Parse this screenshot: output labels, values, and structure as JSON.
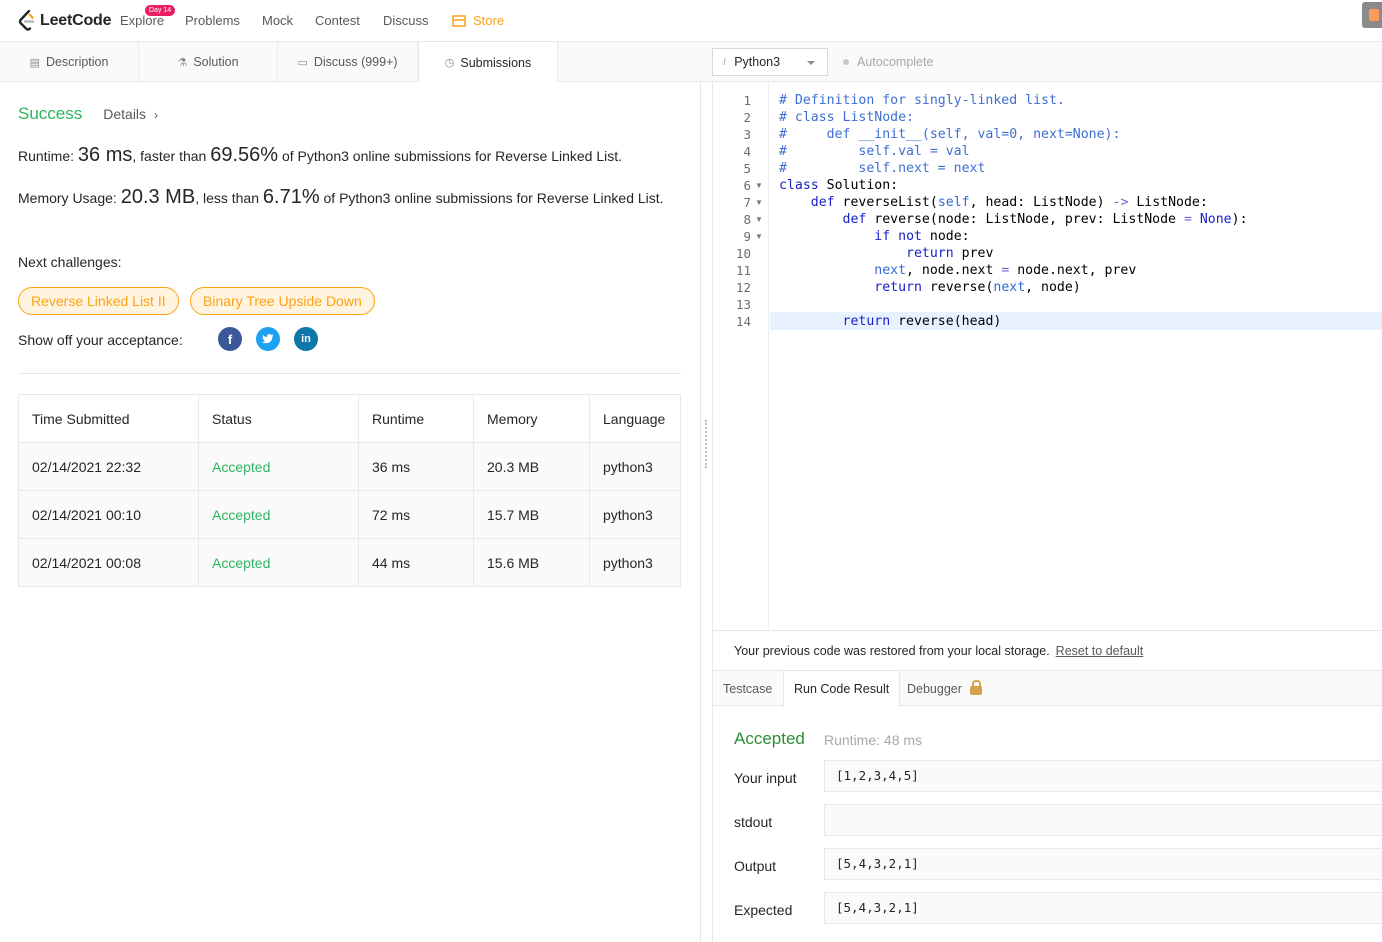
{
  "nav": {
    "logo": "LeetCode",
    "explore": "Explore",
    "explore_badge": "Day 14",
    "problems": "Problems",
    "mock": "Mock",
    "contest": "Contest",
    "discuss": "Discuss",
    "store": "Store"
  },
  "tabs": {
    "description": "Description",
    "solution": "Solution",
    "discuss": "Discuss (999+)",
    "submissions": "Submissions"
  },
  "editor_toolbar": {
    "language": "Python3",
    "autocomplete": "Autocomplete"
  },
  "result": {
    "status": "Success",
    "details": "Details",
    "runtime_label": "Runtime: ",
    "runtime_value": "36 ms",
    "runtime_mid": ", faster than ",
    "runtime_pct": "69.56%",
    "runtime_suffix": " of Python3 online submissions for Reverse Linked List.",
    "memory_label": "Memory Usage: ",
    "memory_value": "20.3 MB",
    "memory_mid": ", less than ",
    "memory_pct": "6.71%",
    "memory_suffix": " of Python3 online submissions for Reverse Linked List.",
    "next_label": "Next challenges:",
    "challenges": [
      "Reverse Linked List II",
      "Binary Tree Upside Down"
    ],
    "share_label": "Show off your acceptance:"
  },
  "submissions": {
    "headers": [
      "Time Submitted",
      "Status",
      "Runtime",
      "Memory",
      "Language"
    ],
    "rows": [
      [
        "02/14/2021 22:32",
        "Accepted",
        "36 ms",
        "20.3 MB",
        "python3"
      ],
      [
        "02/14/2021 00:10",
        "Accepted",
        "72 ms",
        "15.7 MB",
        "python3"
      ],
      [
        "02/14/2021 00:08",
        "Accepted",
        "44 ms",
        "15.6 MB",
        "python3"
      ]
    ]
  },
  "code": {
    "line_numbers": [
      "1",
      "2",
      "3",
      "4",
      "5",
      "6",
      "7",
      "8",
      "9",
      "10",
      "11",
      "12",
      "13",
      "14"
    ],
    "lines": [
      "# Definition for singly-linked list.",
      "# class ListNode:",
      "#     def __init__(self, val=0, next=None):",
      "#         self.val = val",
      "#         self.next = next",
      "class Solution:",
      "    def reverseList(self, head: ListNode) -> ListNode:",
      "        def reverse(node: ListNode, prev: ListNode = None):",
      "            if not node:",
      "                return prev",
      "            next, node.next = node.next, prev",
      "            return reverse(next, node)",
      "",
      "        return reverse(head)"
    ]
  },
  "console": {
    "restore_msg": "Your previous code was restored from your local storage.",
    "reset_link": "Reset to default",
    "tab_testcase": "Testcase",
    "tab_result": "Run Code Result",
    "tab_debugger": "Debugger",
    "status": "Accepted",
    "runtime": "Runtime: 48 ms",
    "input_label": "Your input",
    "input_value": "[1,2,3,4,5]",
    "stdout_label": "stdout",
    "stdout_value": "",
    "output_label": "Output",
    "output_value": "[5,4,3,2,1]",
    "expected_label": "Expected",
    "expected_value": "[5,4,3,2,1]"
  },
  "colors": {
    "accent": "#ffa116",
    "success": "#2db55d",
    "facebook": "#3b5998",
    "twitter": "#1da1f2",
    "linkedin": "#0e76a8"
  }
}
